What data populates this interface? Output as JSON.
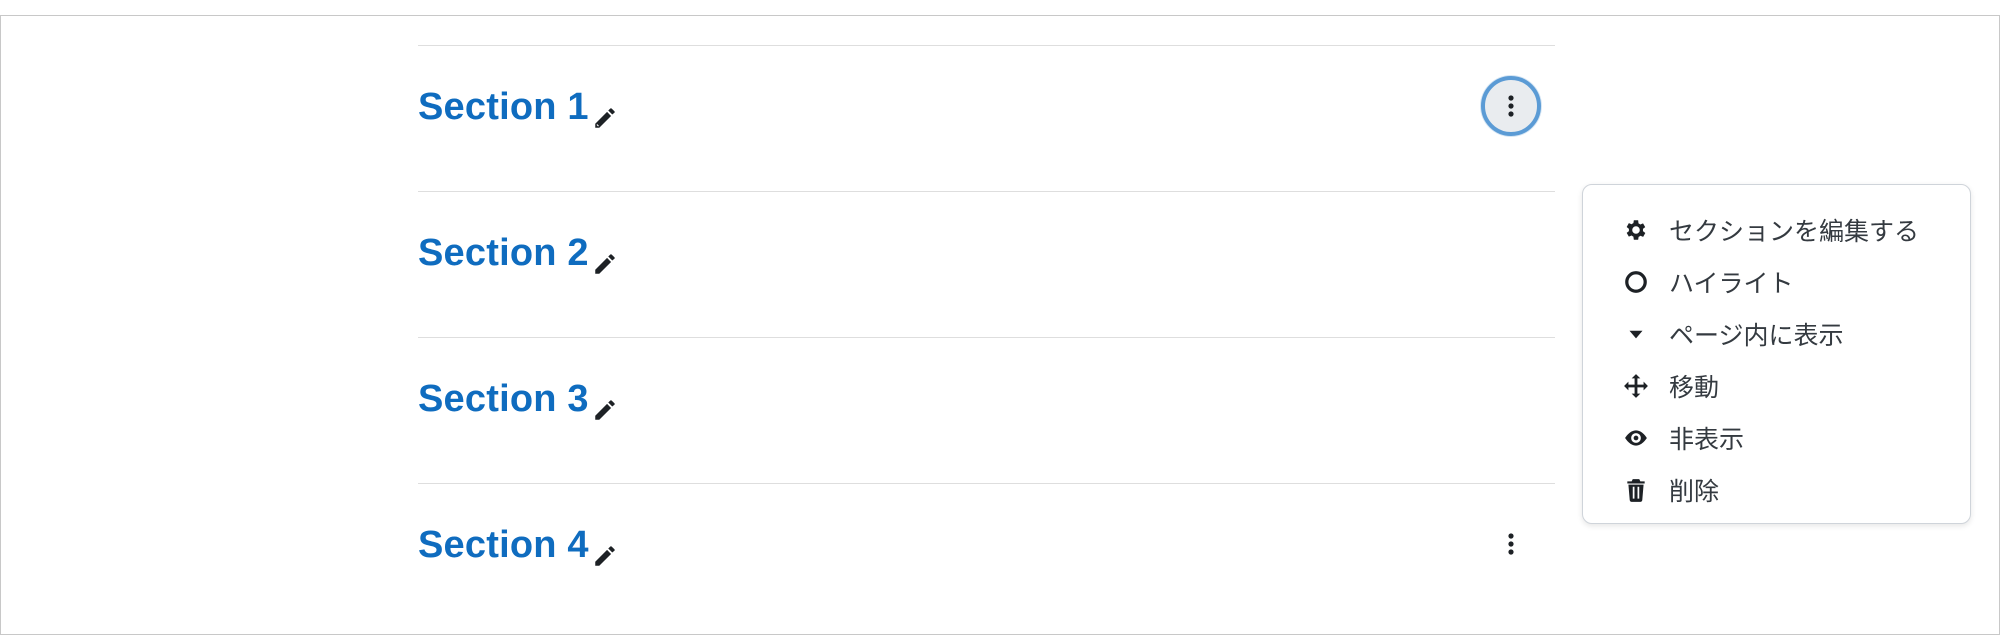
{
  "sections": [
    {
      "title": "Section 1"
    },
    {
      "title": "Section 2"
    },
    {
      "title": "Section 3"
    },
    {
      "title": "Section 4"
    }
  ],
  "section_menu": {
    "items": [
      {
        "label": "セクションを編集する",
        "icon": "gear-icon"
      },
      {
        "label": "ハイライト",
        "icon": "circle-outline-icon"
      },
      {
        "label": "ページ内に表示",
        "icon": "caret-down-icon"
      },
      {
        "label": "移動",
        "icon": "move-arrows-icon"
      },
      {
        "label": "非表示",
        "icon": "eye-icon"
      },
      {
        "label": "削除",
        "icon": "trash-icon"
      }
    ]
  },
  "colors": {
    "section_title": "#0f6cbf",
    "focus_ring": "#5b9bd5",
    "menu_text": "#343a40"
  }
}
